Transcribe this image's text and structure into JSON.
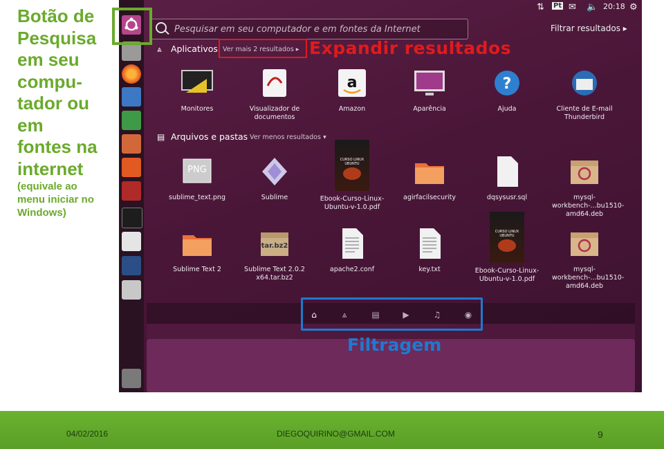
{
  "caption": {
    "title_lines": [
      "Botão de",
      "Pesquisa",
      "em seu",
      "compu-",
      "tador ou",
      "em",
      "fontes na",
      "internet"
    ],
    "subtitle_lines": [
      "(equivale ao",
      "menu iniciar no",
      "Windows)"
    ]
  },
  "topbar": {
    "keyboard": "Pt",
    "time": "20:18"
  },
  "search": {
    "placeholder": "Pesquisar em seu computador e em fontes da Internet",
    "filter_label": "Filtrar resultados ▸"
  },
  "sections": {
    "apps": {
      "title": "Aplicativos",
      "more": "Ver mais 2 resultados ▸"
    },
    "files": {
      "title": "Arquivos e pastas",
      "more": "Ver menos resultados ▾"
    }
  },
  "apps": [
    {
      "label": "Monitores",
      "icon": "monitor-ruler-icon"
    },
    {
      "label": "Visualizador de documentos",
      "icon": "document-viewer-icon"
    },
    {
      "label": "Amazon",
      "icon": "amazon-icon"
    },
    {
      "label": "Aparência",
      "icon": "appearance-icon"
    },
    {
      "label": "Ajuda",
      "icon": "help-icon"
    },
    {
      "label": "Cliente de E-mail Thunderbird",
      "icon": "thunderbird-icon"
    }
  ],
  "files_row1": [
    {
      "label": "sublime_text.png",
      "icon": "png-file-icon",
      "badge": "PNG"
    },
    {
      "label": "Sublime",
      "icon": "sublime-icon"
    },
    {
      "label": "Ebook-Curso-Linux-Ubuntu-v-1.0.pdf",
      "icon": "pdf-cover-icon",
      "cover": "CURSO LINUX UBUNTU"
    },
    {
      "label": "agirfacilsecurity",
      "icon": "folder-icon"
    },
    {
      "label": "dqsysusr.sql",
      "icon": "blank-file-icon"
    },
    {
      "label": "mysql-workbench-...bu1510-amd64.deb",
      "icon": "deb-package-icon"
    }
  ],
  "files_row2": [
    {
      "label": "Sublime Text 2",
      "icon": "folder-icon"
    },
    {
      "label": "Sublime Text 2.0.2 x64.tar.bz2",
      "icon": "archive-icon",
      "badge": "tar.bz2"
    },
    {
      "label": "apache2.conf",
      "icon": "text-file-icon"
    },
    {
      "label": "key.txt",
      "icon": "text-file-icon"
    },
    {
      "label": "Ebook-Curso-Linux-Ubuntu-v-1.0.pdf",
      "icon": "pdf-cover-icon",
      "cover": "CURSO LINUX UBUNTU"
    },
    {
      "label": "mysql-workbench-...bu1510-amd64.deb",
      "icon": "deb-package-icon"
    }
  ],
  "lenses": [
    "home-lens-icon",
    "apps-lens-icon",
    "files-lens-icon",
    "video-lens-icon",
    "music-lens-icon",
    "photo-lens-icon"
  ],
  "annotations": {
    "expand": "Expandir resultados",
    "filter": "Filtragem"
  },
  "footer": {
    "date": "04/02/2016",
    "email": "DIEGOQUIRINO@GMAIL.COM",
    "page": "9"
  },
  "colors": {
    "green": "#6aaa2c",
    "red": "#e01b1b",
    "blue": "#1e7ad0",
    "dash_bg": "#4a1638"
  }
}
